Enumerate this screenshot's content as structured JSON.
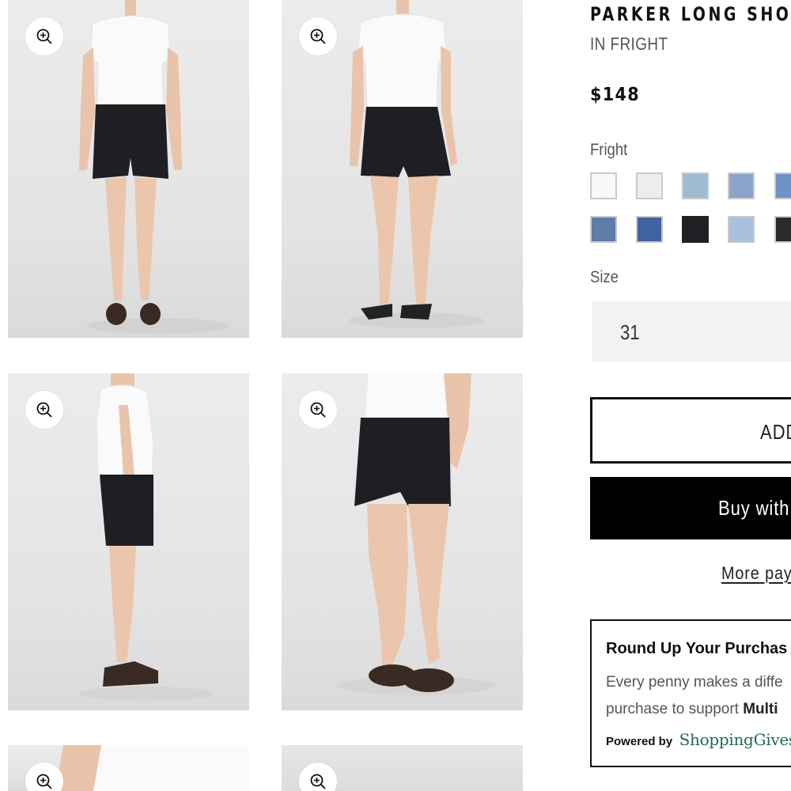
{
  "product": {
    "title": "PARKER LONG SHO",
    "color_name": "IN FRIGHT",
    "price": "$148"
  },
  "color": {
    "label": "Fright",
    "swatches": [
      {
        "name": "white",
        "color": "#f8f8f8"
      },
      {
        "name": "off-white",
        "color": "#eceeed"
      },
      {
        "name": "light-wash",
        "color": "#9dbbd3"
      },
      {
        "name": "mid-light-wash",
        "color": "#8ca3cc"
      },
      {
        "name": "bright-wash",
        "color": "#6d93c6"
      },
      {
        "name": "mid-wash",
        "color": "#5e7da8"
      },
      {
        "name": "dark-blue",
        "color": "#3f62a0"
      },
      {
        "name": "fright-black",
        "color": "#1f2023",
        "selected": true
      },
      {
        "name": "pale-wash",
        "color": "#a9bfdd"
      },
      {
        "name": "black",
        "color": "#2a2a2a"
      }
    ]
  },
  "size": {
    "label": "Size",
    "value": "31"
  },
  "buttons": {
    "add_to_cart": "ADD",
    "buy_with": "Buy with",
    "more_payment": "More pay"
  },
  "roundup": {
    "title": "Round Up Your Purchas",
    "line1": "Every penny makes a diffe",
    "line2_prefix": "purchase to support ",
    "line2_bold": "Multi",
    "powered_by": "Powered by",
    "brand": "ShoppingGives"
  },
  "icons": {
    "zoom": "zoom-in-icon"
  }
}
